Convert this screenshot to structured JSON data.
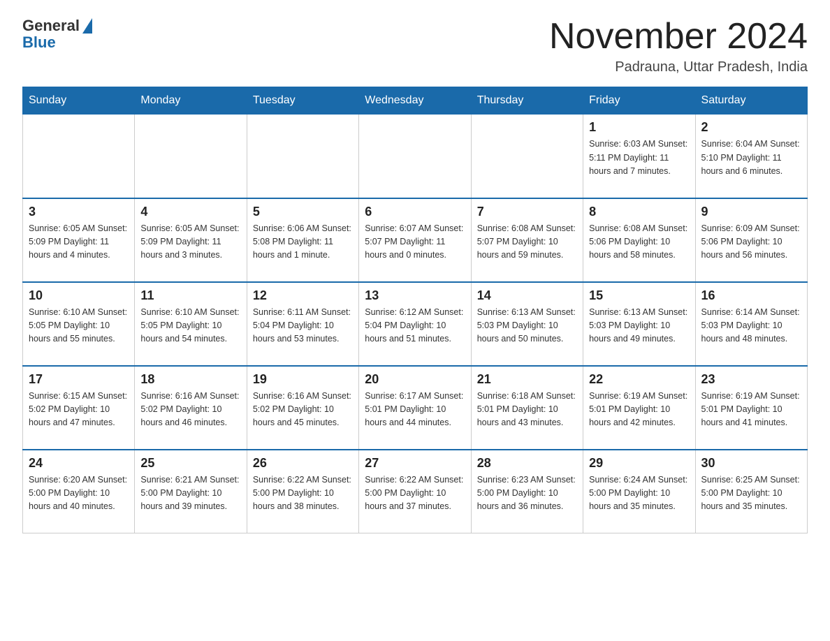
{
  "logo": {
    "general": "General",
    "blue": "Blue"
  },
  "title": "November 2024",
  "location": "Padrauna, Uttar Pradesh, India",
  "days_of_week": [
    "Sunday",
    "Monday",
    "Tuesday",
    "Wednesday",
    "Thursday",
    "Friday",
    "Saturday"
  ],
  "weeks": [
    [
      {
        "day": "",
        "info": ""
      },
      {
        "day": "",
        "info": ""
      },
      {
        "day": "",
        "info": ""
      },
      {
        "day": "",
        "info": ""
      },
      {
        "day": "",
        "info": ""
      },
      {
        "day": "1",
        "info": "Sunrise: 6:03 AM\nSunset: 5:11 PM\nDaylight: 11 hours\nand 7 minutes."
      },
      {
        "day": "2",
        "info": "Sunrise: 6:04 AM\nSunset: 5:10 PM\nDaylight: 11 hours\nand 6 minutes."
      }
    ],
    [
      {
        "day": "3",
        "info": "Sunrise: 6:05 AM\nSunset: 5:09 PM\nDaylight: 11 hours\nand 4 minutes."
      },
      {
        "day": "4",
        "info": "Sunrise: 6:05 AM\nSunset: 5:09 PM\nDaylight: 11 hours\nand 3 minutes."
      },
      {
        "day": "5",
        "info": "Sunrise: 6:06 AM\nSunset: 5:08 PM\nDaylight: 11 hours\nand 1 minute."
      },
      {
        "day": "6",
        "info": "Sunrise: 6:07 AM\nSunset: 5:07 PM\nDaylight: 11 hours\nand 0 minutes."
      },
      {
        "day": "7",
        "info": "Sunrise: 6:08 AM\nSunset: 5:07 PM\nDaylight: 10 hours\nand 59 minutes."
      },
      {
        "day": "8",
        "info": "Sunrise: 6:08 AM\nSunset: 5:06 PM\nDaylight: 10 hours\nand 58 minutes."
      },
      {
        "day": "9",
        "info": "Sunrise: 6:09 AM\nSunset: 5:06 PM\nDaylight: 10 hours\nand 56 minutes."
      }
    ],
    [
      {
        "day": "10",
        "info": "Sunrise: 6:10 AM\nSunset: 5:05 PM\nDaylight: 10 hours\nand 55 minutes."
      },
      {
        "day": "11",
        "info": "Sunrise: 6:10 AM\nSunset: 5:05 PM\nDaylight: 10 hours\nand 54 minutes."
      },
      {
        "day": "12",
        "info": "Sunrise: 6:11 AM\nSunset: 5:04 PM\nDaylight: 10 hours\nand 53 minutes."
      },
      {
        "day": "13",
        "info": "Sunrise: 6:12 AM\nSunset: 5:04 PM\nDaylight: 10 hours\nand 51 minutes."
      },
      {
        "day": "14",
        "info": "Sunrise: 6:13 AM\nSunset: 5:03 PM\nDaylight: 10 hours\nand 50 minutes."
      },
      {
        "day": "15",
        "info": "Sunrise: 6:13 AM\nSunset: 5:03 PM\nDaylight: 10 hours\nand 49 minutes."
      },
      {
        "day": "16",
        "info": "Sunrise: 6:14 AM\nSunset: 5:03 PM\nDaylight: 10 hours\nand 48 minutes."
      }
    ],
    [
      {
        "day": "17",
        "info": "Sunrise: 6:15 AM\nSunset: 5:02 PM\nDaylight: 10 hours\nand 47 minutes."
      },
      {
        "day": "18",
        "info": "Sunrise: 6:16 AM\nSunset: 5:02 PM\nDaylight: 10 hours\nand 46 minutes."
      },
      {
        "day": "19",
        "info": "Sunrise: 6:16 AM\nSunset: 5:02 PM\nDaylight: 10 hours\nand 45 minutes."
      },
      {
        "day": "20",
        "info": "Sunrise: 6:17 AM\nSunset: 5:01 PM\nDaylight: 10 hours\nand 44 minutes."
      },
      {
        "day": "21",
        "info": "Sunrise: 6:18 AM\nSunset: 5:01 PM\nDaylight: 10 hours\nand 43 minutes."
      },
      {
        "day": "22",
        "info": "Sunrise: 6:19 AM\nSunset: 5:01 PM\nDaylight: 10 hours\nand 42 minutes."
      },
      {
        "day": "23",
        "info": "Sunrise: 6:19 AM\nSunset: 5:01 PM\nDaylight: 10 hours\nand 41 minutes."
      }
    ],
    [
      {
        "day": "24",
        "info": "Sunrise: 6:20 AM\nSunset: 5:00 PM\nDaylight: 10 hours\nand 40 minutes."
      },
      {
        "day": "25",
        "info": "Sunrise: 6:21 AM\nSunset: 5:00 PM\nDaylight: 10 hours\nand 39 minutes."
      },
      {
        "day": "26",
        "info": "Sunrise: 6:22 AM\nSunset: 5:00 PM\nDaylight: 10 hours\nand 38 minutes."
      },
      {
        "day": "27",
        "info": "Sunrise: 6:22 AM\nSunset: 5:00 PM\nDaylight: 10 hours\nand 37 minutes."
      },
      {
        "day": "28",
        "info": "Sunrise: 6:23 AM\nSunset: 5:00 PM\nDaylight: 10 hours\nand 36 minutes."
      },
      {
        "day": "29",
        "info": "Sunrise: 6:24 AM\nSunset: 5:00 PM\nDaylight: 10 hours\nand 35 minutes."
      },
      {
        "day": "30",
        "info": "Sunrise: 6:25 AM\nSunset: 5:00 PM\nDaylight: 10 hours\nand 35 minutes."
      }
    ]
  ]
}
